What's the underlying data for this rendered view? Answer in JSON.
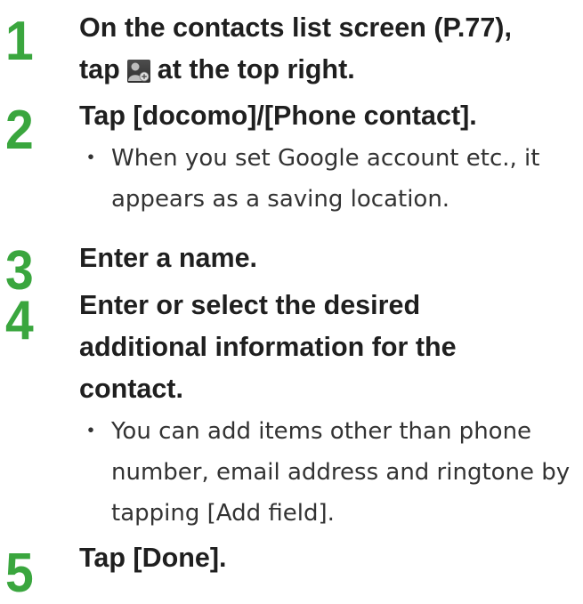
{
  "steps": [
    {
      "number": "1",
      "title_part1": "On the contacts list screen (P.77),",
      "title_part2_pre": "tap",
      "title_icon": "add-contact-icon",
      "title_part2_post": "at the top right."
    },
    {
      "number": "2",
      "title": "Tap [docomo]/[Phone contact].",
      "note": "When you set Google account etc., it appears as a saving location."
    },
    {
      "number": "3",
      "title": "Enter a name."
    },
    {
      "number": "4",
      "title": "Enter or select the desired additional information for the contact.",
      "note": "You can add items other than phone number, email address and ringtone by tapping [Add field]."
    },
    {
      "number": "5",
      "title": "Tap [Done]."
    }
  ],
  "bullet_symbol": "・",
  "colors": {
    "step_number": "#3aa63e",
    "text": "#1f1f1f"
  }
}
